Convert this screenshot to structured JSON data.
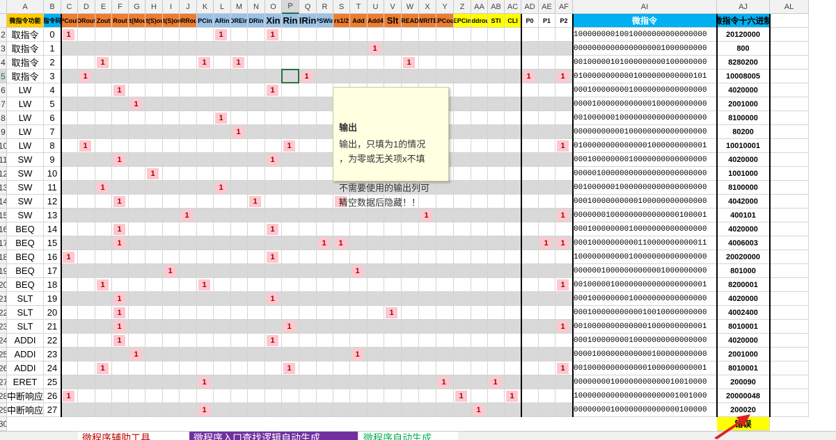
{
  "column_letters": [
    "A",
    "B",
    "C",
    "D",
    "E",
    "F",
    "G",
    "H",
    "I",
    "J",
    "K",
    "L",
    "M",
    "N",
    "O",
    "P",
    "Q",
    "R",
    "S",
    "T",
    "U",
    "V",
    "W",
    "X",
    "Y",
    "Z",
    "AA",
    "AB",
    "AC",
    "AD",
    "AE",
    "AF",
    "AI",
    "AJ",
    "AL"
  ],
  "selected_column": "P",
  "selected_row": "5",
  "header_row": {
    "row_number": "2",
    "labels": [
      "微指令功能",
      "状态/指令码/编码",
      "PCout",
      "DRout",
      "Zout",
      "Rout",
      "Rt(Mout",
      "Rt(S)out",
      "Rt(S)out",
      "DRRout",
      "PCin",
      "ARin",
      "DREin",
      "DRin",
      "Xin",
      "Rin",
      "IRin",
      "PSWin",
      "rs1/2",
      "Add",
      "Add4",
      "Slt",
      "READ",
      "WRITE",
      "EPCout",
      "EPCin",
      "Addrout",
      "STI",
      "CLI",
      "P0",
      "P1",
      "P2",
      "微指令",
      "微指令十六进制"
    ],
    "colors": {
      "yellow": "#ffcc00",
      "orange": "#ed7d31",
      "blue": "#9bc2e6",
      "bright_yellow": "#ffff00",
      "cyan": "#00b0f0",
      "dark": "#000000"
    }
  },
  "rows": [
    {
      "row": "2",
      "fn": "取指令",
      "state": "0",
      "bits": "10000000010010000000000000000",
      "hex": "20120000",
      "ones": [
        2,
        11,
        14
      ]
    },
    {
      "row": "3",
      "fn": "取指令",
      "state": "1",
      "bits": "00000000000000000001000000000",
      "hex": "800",
      "ones": [
        20
      ]
    },
    {
      "row": "4",
      "fn": "取指令",
      "state": "2",
      "bits": "00100000101000000000100000000",
      "hex": "8280200",
      "ones": [
        4,
        10,
        12,
        22
      ]
    },
    {
      "row": "5",
      "fn": "取指令",
      "state": "3",
      "bits": "01000000000001000000000000101",
      "hex": "10008005",
      "ones": [
        3,
        16,
        29,
        31
      ]
    },
    {
      "row": "6",
      "fn": "LW",
      "state": "4",
      "bits": "00010000000010000000000000000",
      "hex": "4020000",
      "ones": [
        5,
        14
      ]
    },
    {
      "row": "7",
      "fn": "LW",
      "state": "5",
      "bits": "00001000000000000100000000000",
      "hex": "2001000",
      "ones": [
        6
      ]
    },
    {
      "row": "8",
      "fn": "LW",
      "state": "6",
      "bits": "00100000010000000000000000000",
      "hex": "8100000",
      "ones": [
        11
      ]
    },
    {
      "row": "9",
      "fn": "LW",
      "state": "7",
      "bits": "00000000000100000000000000000",
      "hex": "80200",
      "ones": [
        12
      ]
    },
    {
      "row": "10",
      "fn": "LW",
      "state": "8",
      "bits": "01000000000000001000000000001",
      "hex": "10010001",
      "ones": [
        3,
        15,
        31
      ]
    },
    {
      "row": "11",
      "fn": "SW",
      "state": "9",
      "bits": "00010000000010000000000000000",
      "hex": "4020000",
      "ones": [
        5,
        14
      ]
    },
    {
      "row": "12",
      "fn": "SW",
      "state": "10",
      "bits": "00000100000000000000000000000",
      "hex": "1001000",
      "ones": [
        7
      ]
    },
    {
      "row": "13",
      "fn": "SW",
      "state": "11",
      "bits": "00100000010000000000000000000",
      "hex": "8100000",
      "ones": [
        4,
        11
      ]
    },
    {
      "row": "14",
      "fn": "SW",
      "state": "12",
      "bits": "00010000000000100000000000000",
      "hex": "4042000",
      "ones": [
        5,
        13,
        18
      ]
    },
    {
      "row": "15",
      "fn": "SW",
      "state": "13",
      "bits": "00000001000000000000000100001",
      "hex": "400101",
      "ones": [
        9,
        23,
        31
      ]
    },
    {
      "row": "16",
      "fn": "BEQ",
      "state": "14",
      "bits": "00010000000010000000000000000",
      "hex": "4020000",
      "ones": [
        5,
        14
      ]
    },
    {
      "row": "17",
      "fn": "BEQ",
      "state": "15",
      "bits": "00010000000000110000000000011",
      "hex": "4006003",
      "ones": [
        5,
        17,
        18,
        30,
        31
      ]
    },
    {
      "row": "18",
      "fn": "BEQ",
      "state": "16",
      "bits": "10000000000010000000000000000",
      "hex": "20020000",
      "ones": [
        2,
        14
      ]
    },
    {
      "row": "19",
      "fn": "BEQ",
      "state": "17",
      "bits": "00000010000000000001000000000",
      "hex": "801000",
      "ones": [
        8,
        19
      ]
    },
    {
      "row": "20",
      "fn": "BEQ",
      "state": "18",
      "bits": "00100000100000000000000000001",
      "hex": "8200001",
      "ones": [
        4,
        10,
        31
      ]
    },
    {
      "row": "21",
      "fn": "SLT",
      "state": "19",
      "bits": "00010000000010000000000000000",
      "hex": "4020000",
      "ones": [
        5,
        14
      ]
    },
    {
      "row": "22",
      "fn": "SLT",
      "state": "20",
      "bits": "00010000000000010010000000000",
      "hex": "4002400",
      "ones": [
        5,
        21
      ]
    },
    {
      "row": "23",
      "fn": "SLT",
      "state": "21",
      "bits": "00100000000000001000000000001",
      "hex": "8010001",
      "ones": [
        5,
        15,
        31
      ]
    },
    {
      "row": "24",
      "fn": "ADDI",
      "state": "22",
      "bits": "00010000000010000000000000000",
      "hex": "4020000",
      "ones": [
        5,
        14
      ]
    },
    {
      "row": "25",
      "fn": "ADDI",
      "state": "23",
      "bits": "00001000000000000100000000000",
      "hex": "2001000",
      "ones": [
        6,
        19
      ]
    },
    {
      "row": "26",
      "fn": "ADDI",
      "state": "24",
      "bits": "00100000000000001000000000001",
      "hex": "8010001",
      "ones": [
        4,
        15,
        31
      ]
    },
    {
      "row": "27",
      "fn": "ERET",
      "state": "25",
      "bits": "00000000100000000000010010000",
      "hex": "200090",
      "ones": [
        10,
        24,
        27
      ]
    },
    {
      "row": "28",
      "fn": "中断响应",
      "state": "26",
      "bits": "10000000000000000000001001000",
      "hex": "20000048",
      "ones": [
        2,
        25,
        28
      ]
    },
    {
      "row": "29",
      "fn": "中断响应",
      "state": "27",
      "bits": "00000000100000000000000100000",
      "hex": "200020",
      "ones": [
        10,
        26
      ]
    }
  ],
  "row30": {
    "row": "30",
    "error_label": "错误"
  },
  "one_value": "1",
  "tooltip": {
    "title": "输出",
    "body": "输出，只填为1的情况\n，为零或无关项x不填\n\n不需要使用的输出列可\n清空数据后隐藏！！"
  },
  "sheet_tabs": [
    "微程序辅助工具",
    "微程序入口查找逻辑自动生成",
    "微程序自动生成"
  ],
  "left_edge_letters": [
    "e",
    "F"
  ]
}
